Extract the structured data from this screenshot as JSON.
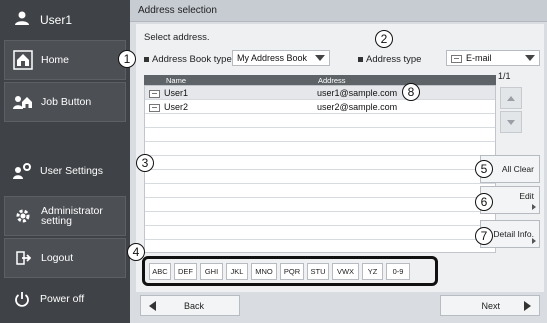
{
  "sidebar": {
    "user": "User1",
    "items": [
      {
        "label": "Home"
      },
      {
        "label": "Job Button"
      },
      {
        "label": "User Settings"
      },
      {
        "label": "Administrator setting"
      },
      {
        "label": "Logout"
      },
      {
        "label": "Power off"
      }
    ]
  },
  "title": "Address selection",
  "instruction": "Select address.",
  "address_book": {
    "label": "Address Book type",
    "value": "My Address Book"
  },
  "address_type": {
    "label": "Address type",
    "value": "E-mail"
  },
  "list": {
    "columns": [
      "Name",
      "Address"
    ],
    "rows": [
      {
        "name": "User1",
        "address": "user1@sample.com"
      },
      {
        "name": "User2",
        "address": "user2@sample.com"
      }
    ],
    "page": "1/1"
  },
  "actions": {
    "all_clear": "All Clear",
    "edit": "Edit",
    "detail": "Detail Info."
  },
  "alpha_keys": [
    "ABC",
    "DEF",
    "GHI",
    "JKL",
    "MNO",
    "PQR",
    "STU",
    "VWX",
    "YZ",
    "0-9"
  ],
  "nav": {
    "back": "Back",
    "next": "Next"
  },
  "callouts": [
    "1",
    "2",
    "3",
    "4",
    "5",
    "6",
    "7",
    "8"
  ],
  "colors": {
    "sidebar": "#3f4246",
    "header": "#5e6368",
    "frame": "#d9dde2"
  }
}
